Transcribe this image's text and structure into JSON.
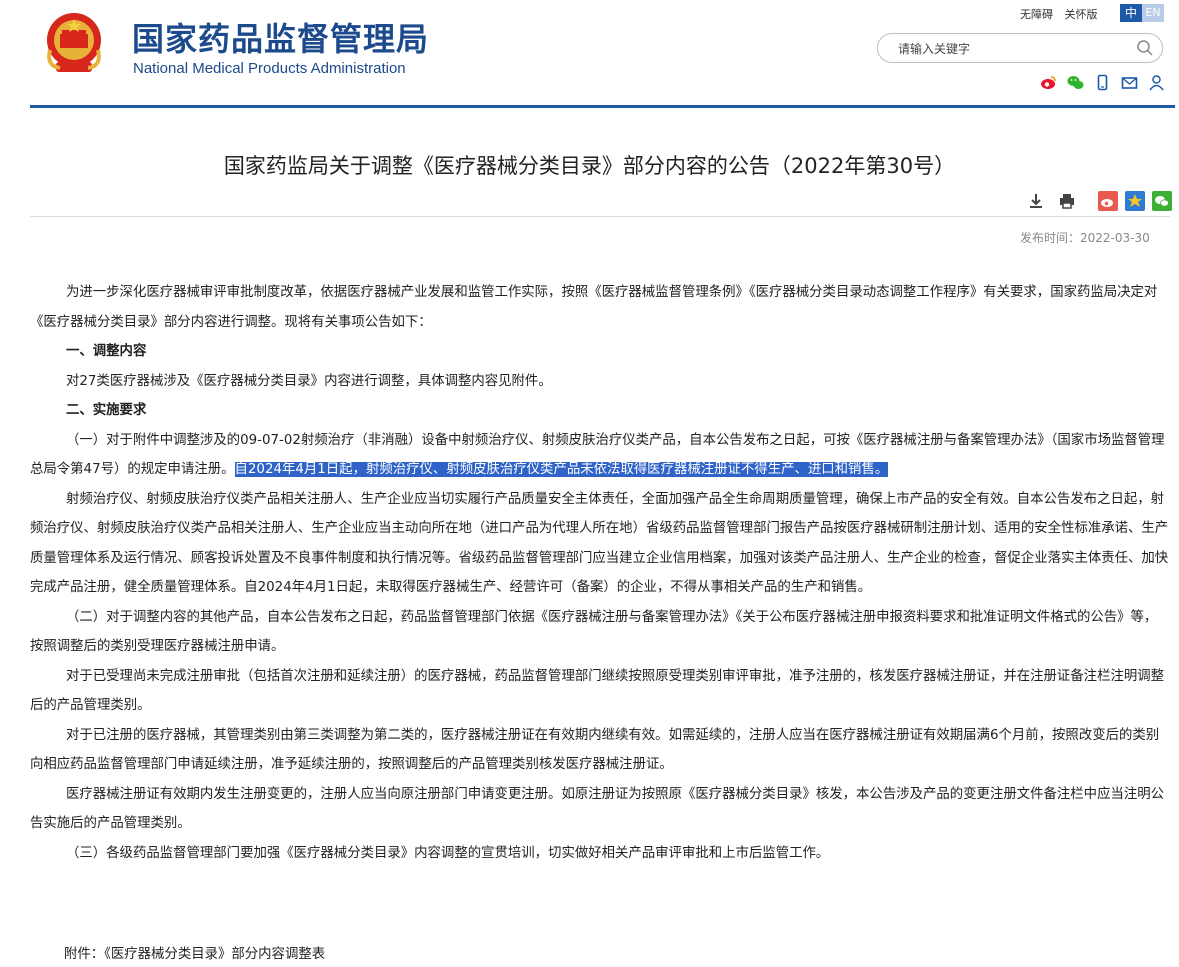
{
  "header": {
    "title_cn": "国家药品监督管理局",
    "title_en": "National Medical Products Administration",
    "util_links": [
      "无障碍",
      "关怀版"
    ],
    "lang_cn": "中",
    "lang_en": "EN",
    "search_placeholder": "请输入关键字",
    "social_icons": [
      "weibo-icon",
      "wechat-icon",
      "mobile-icon",
      "mail-icon",
      "user-icon"
    ],
    "accent_color": "#1c5aa8"
  },
  "article": {
    "title": "国家药监局关于调整《医疗器械分类目录》部分内容的公告（2022年第30号）",
    "tools": [
      "download-icon",
      "print-icon",
      "share-weibo-icon",
      "share-qzone-icon",
      "share-wechat-icon"
    ],
    "publish_label": "发布时间：",
    "publish_date": "2022-03-30",
    "paragraphs": {
      "p1": "为进一步深化医疗器械审评审批制度改革，依据医疗器械产业发展和监管工作实际，按照《医疗器械监督管理条例》《医疗器械分类目录动态调整工作程序》有关要求，国家药监局决定对《医疗器械分类目录》部分内容进行调整。现将有关事项公告如下：",
      "s1": "一、调整内容",
      "p2": "对27类医疗器械涉及《医疗器械分类目录》内容进行调整，具体调整内容见附件。",
      "s2": "二、实施要求",
      "p3a": "（一）对于附件中调整涉及的09-07-02射频治疗（非消融）设备中射频治疗仪、射频皮肤治疗仪类产品，自本公告发布之日起，可按《医疗器械注册与备案管理办法》（国家市场监督管理总局令第47号）的规定申请注册。",
      "p3b": "自2024年4月1日起，射频治疗仪、射频皮肤治疗仪类产品未依法取得医疗器械注册证不得生产、进口和销售。",
      "p4": "射频治疗仪、射频皮肤治疗仪类产品相关注册人、生产企业应当切实履行产品质量安全主体责任，全面加强产品全生命周期质量管理，确保上市产品的安全有效。自本公告发布之日起，射频治疗仪、射频皮肤治疗仪类产品相关注册人、生产企业应当主动向所在地（进口产品为代理人所在地）省级药品监督管理部门报告产品按医疗器械研制注册计划、适用的安全性标准承诺、生产质量管理体系及运行情况、顾客投诉处置及不良事件制度和执行情况等。省级药品监督管理部门应当建立企业信用档案，加强对该类产品注册人、生产企业的检查，督促企业落实主体责任、加快完成产品注册，健全质量管理体系。自2024年4月1日起，未取得医疗器械生产、经营许可（备案）的企业，不得从事相关产品的生产和销售。",
      "p5": "（二）对于调整内容的其他产品，自本公告发布之日起，药品监督管理部门依据《医疗器械注册与备案管理办法》《关于公布医疗器械注册申报资料要求和批准证明文件格式的公告》等，按照调整后的类别受理医疗器械注册申请。",
      "p6": "对于已受理尚未完成注册审批（包括首次注册和延续注册）的医疗器械，药品监督管理部门继续按照原受理类别审评审批，准予注册的，核发医疗器械注册证，并在注册证备注栏注明调整后的产品管理类别。",
      "p7": "对于已注册的医疗器械，其管理类别由第三类调整为第二类的，医疗器械注册证在有效期内继续有效。如需延续的，注册人应当在医疗器械注册证有效期届满6个月前，按照改变后的类别向相应药品监督管理部门申请延续注册，准予延续注册的，按照调整后的产品管理类别核发医疗器械注册证。",
      "p8": "医疗器械注册证有效期内发生注册变更的，注册人应当向原注册部门申请变更注册。如原注册证为按照原《医疗器械分类目录》核发，本公告涉及产品的变更注册文件备注栏中应当注明公告实施后的产品管理类别。",
      "p9": "（三）各级药品监督管理部门要加强《医疗器械分类目录》内容调整的宣贯培训，切实做好相关产品审评审批和上市后监管工作。"
    },
    "attachment": "附件：《医疗器械分类目录》部分内容调整表"
  }
}
